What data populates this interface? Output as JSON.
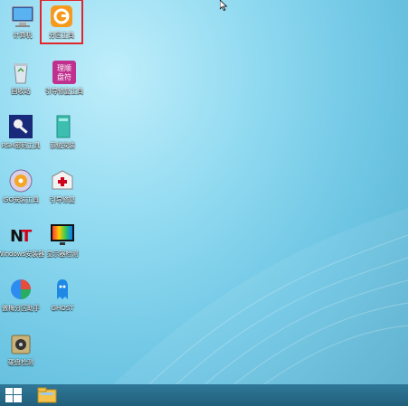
{
  "desktop": {
    "icons": [
      {
        "name": "computer-icon",
        "label": "计算机"
      },
      {
        "name": "partition-tool-icon",
        "label": "分区工具"
      },
      {
        "name": "recycle-bin-icon",
        "label": "回收站"
      },
      {
        "name": "boot-repair-icon",
        "label": "引导修复工具",
        "badge": "理顺盘符"
      },
      {
        "name": "password-key-icon",
        "label": "RSH密码工具"
      },
      {
        "name": "install-system-icon",
        "label": "系统安装"
      },
      {
        "name": "iso-disc-icon",
        "label": "ISO安装工具"
      },
      {
        "name": "first-aid-kit-icon",
        "label": "引导修复"
      },
      {
        "name": "nt-install-icon",
        "label": "Windows安装器"
      },
      {
        "name": "monitor-test-icon",
        "label": "显示器检测"
      },
      {
        "name": "partition-assistant-icon",
        "label": "傲梅分区助手"
      },
      {
        "name": "ghost-icon",
        "label": "GHOST"
      },
      {
        "name": "disk-check-icon",
        "label": "硬盘检测"
      }
    ]
  },
  "taskbar": {
    "start_icon": "windows-logo",
    "pinned": [
      {
        "name": "file-explorer-icon"
      }
    ]
  },
  "colors": {
    "accent": "#e0262c",
    "taskbar": "#2a6d8c"
  }
}
